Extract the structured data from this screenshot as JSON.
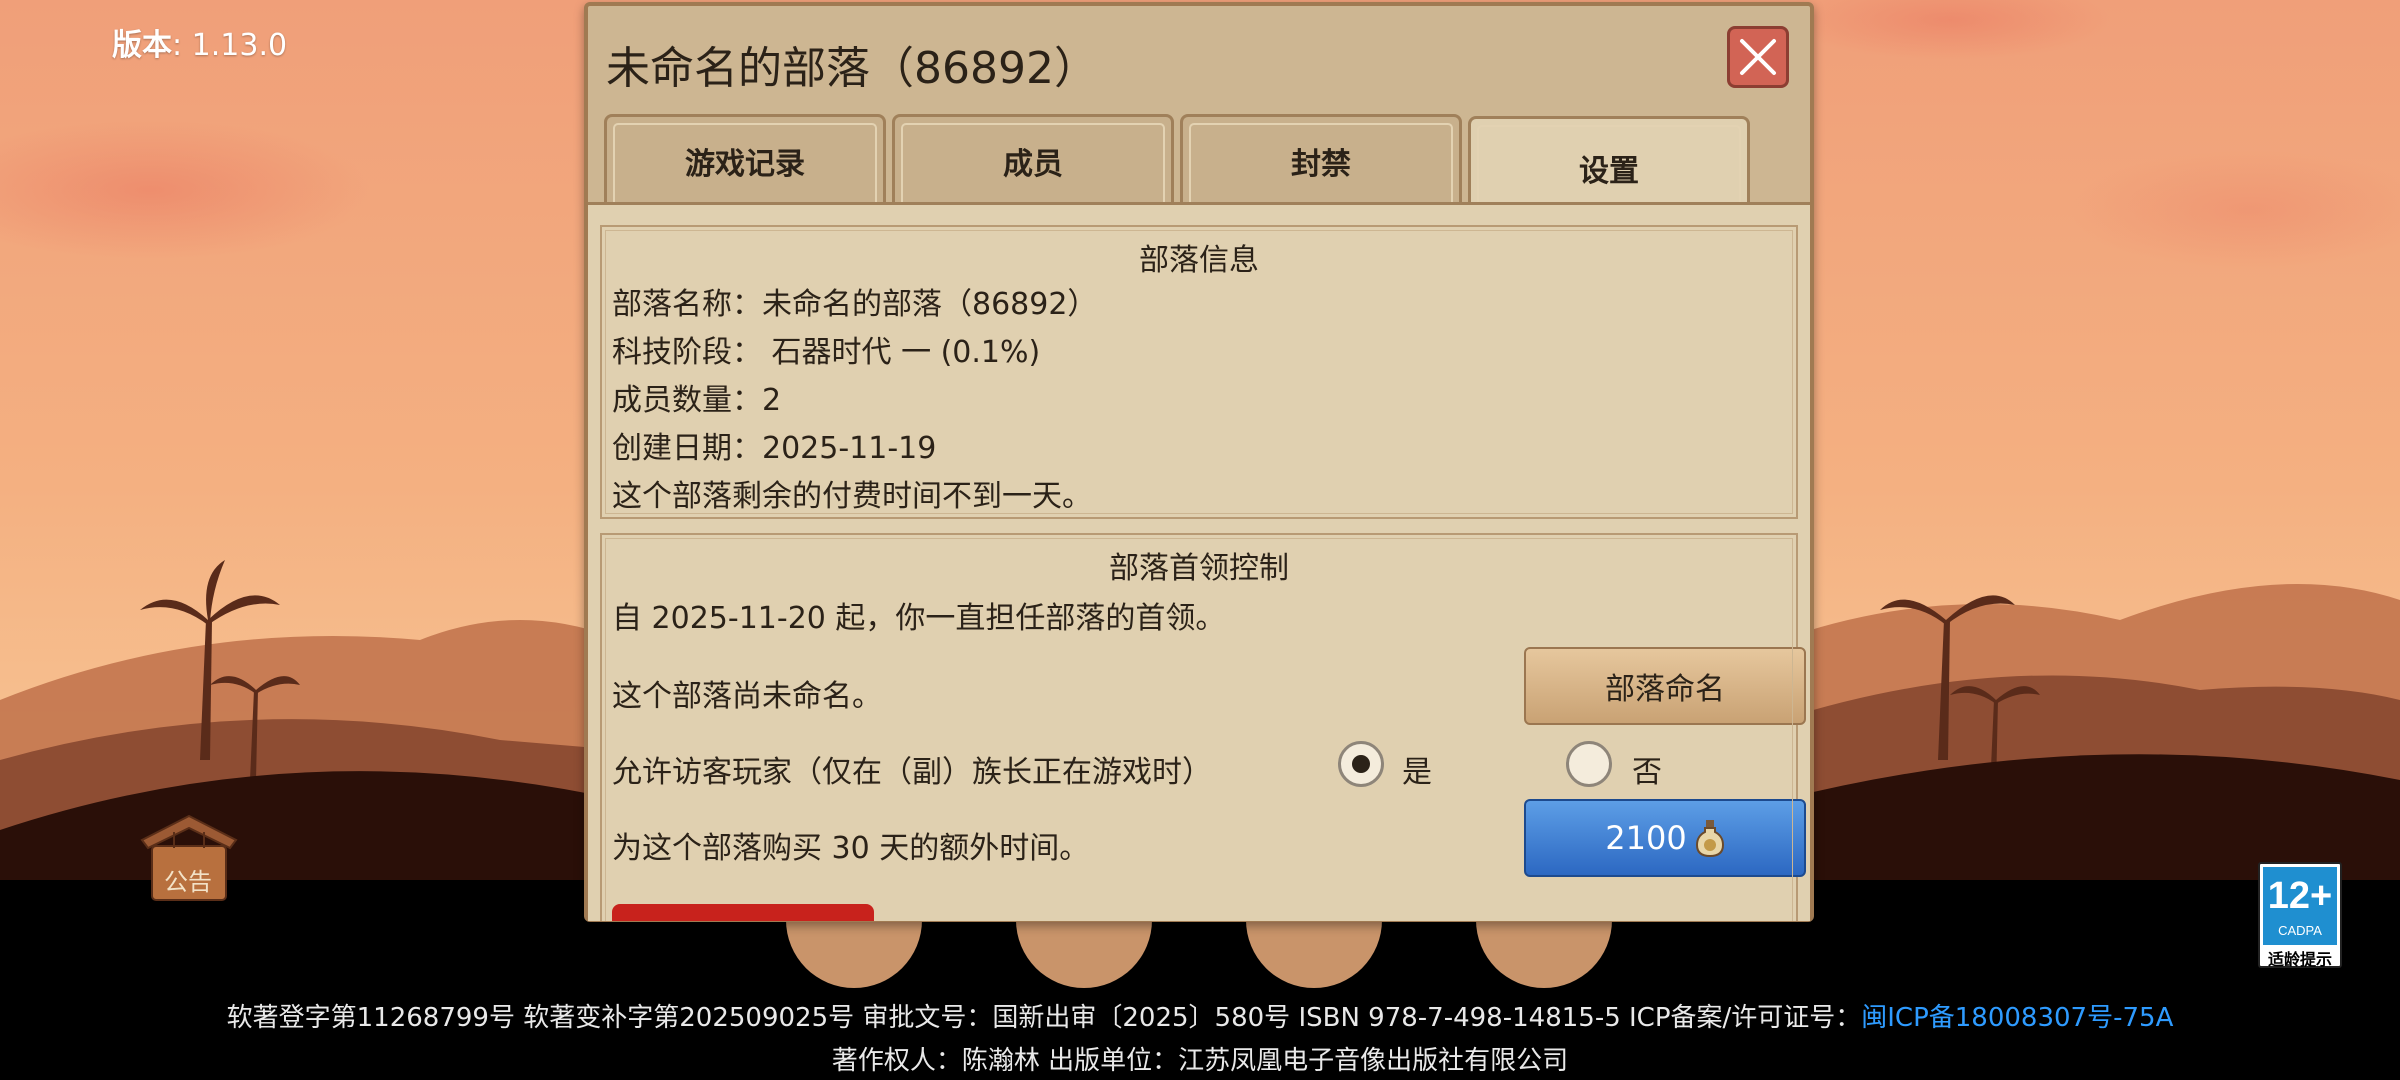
{
  "version": {
    "label": "版本",
    "value": ": 1.13.0"
  },
  "dialog": {
    "title": "未命名的部落（86892）",
    "tabs": [
      {
        "label": "游戏记录",
        "active": false
      },
      {
        "label": "成员",
        "active": false
      },
      {
        "label": "封禁",
        "active": false
      },
      {
        "label": "设置",
        "active": true
      }
    ]
  },
  "info": {
    "heading": "部落信息",
    "name_line": "部落名称：未命名的部落（86892）",
    "tech_line": "科技阶段：  石器时代 一 (0.1%)",
    "members_line": "成员数量：2",
    "created_line": "创建日期：2025-11-19",
    "remaining_line": "这个部落剩余的付费时间不到一天。"
  },
  "leader": {
    "heading": "部落首领控制",
    "since_line": "自 2025-11-20 起，你一直担任部落的首领。",
    "unnamed_line": "这个部落尚未命名。",
    "rename_button": "部落命名",
    "visitor_line": "允许访客玩家（仅在（副）族长正在游戏时）",
    "yes_label": "是",
    "no_label": "否",
    "visitor_allowed": true,
    "buy_line": "为这个部落购买 30 天的额外时间。",
    "buy_price": "2100"
  },
  "notice": {
    "label": "公告"
  },
  "age_badge": {
    "rating": "12+",
    "org": "CADPA",
    "tip": "适龄提示"
  },
  "footer": {
    "line1_text": "软著登字第11268799号 软著变补字第202509025号 审批文号：国新出审〔2025〕580号 ISBN 978-7-498-14815-5 ICP备案/许可证号：",
    "line1_link": "闽ICP备18008307号-75A",
    "line2": "著作权人：陈瀚林 出版单位：江苏凤凰电子音像出版社有限公司"
  },
  "colors": {
    "sky_top": "#f3a57e",
    "sky_mid": "#f6b98a",
    "dialog_bg": "#cdb692",
    "panel_bg": "#e0d0b0",
    "blue_button": "#2c68c2",
    "link": "#2e9bff"
  }
}
